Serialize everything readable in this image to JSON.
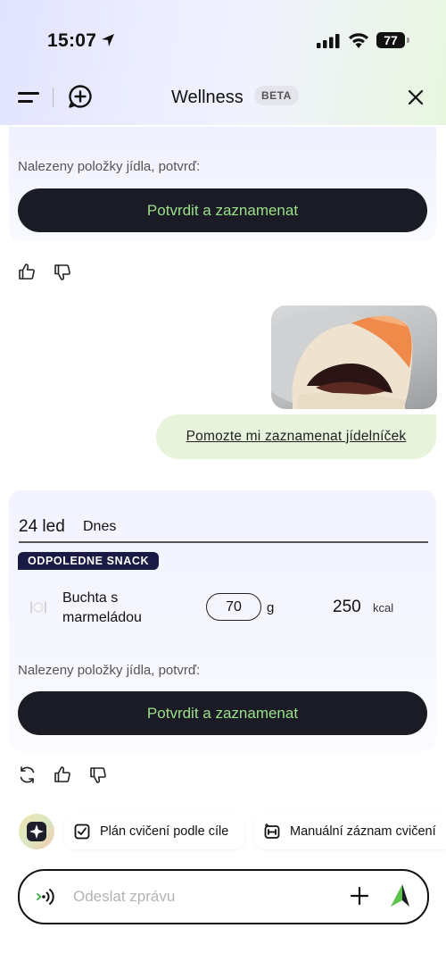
{
  "status_bar": {
    "time": "15:07",
    "battery": "77"
  },
  "header": {
    "title": "Wellness",
    "badge": "BETA"
  },
  "first_message": {
    "note": "Nalezeny položky jídla, potvrď:",
    "confirm_label": "Potvrdit a zaznamenat"
  },
  "user_message": {
    "text": "Pomozte mi zaznamenat jídelníček"
  },
  "food_card": {
    "date": "24 led",
    "day": "Dnes",
    "meal_type": "ODPOLEDNE SNACK",
    "items": [
      {
        "name": "Buchta s marmeládou",
        "quantity": "70",
        "unit": "g",
        "kcal": "250",
        "kcal_unit": "kcal"
      }
    ],
    "note": "Nalezeny položky jídla, potvrď:",
    "confirm_label": "Potvrdit a zaznamenat"
  },
  "suggestions": [
    {
      "label": "Plán cvičení podle cíle",
      "icon": "checkbox-icon"
    },
    {
      "label": "Manuální záznam cvičení",
      "icon": "dumbbell-icon"
    }
  ],
  "composer": {
    "placeholder": "Odeslat zprávu"
  },
  "colors": {
    "accent_green": "#9be08a",
    "dark_button": "#1a1b25",
    "user_bubble": "#e8f3dc"
  }
}
